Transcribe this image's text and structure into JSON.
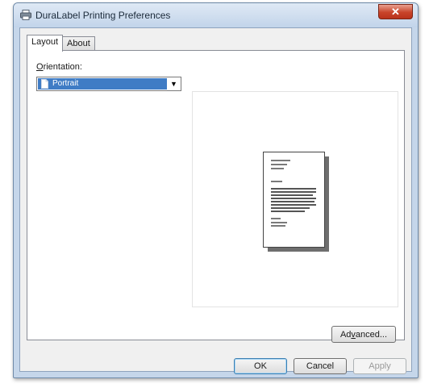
{
  "window": {
    "title": "DuraLabel Printing Preferences",
    "close_symbol": "✕",
    "app_icon": "printer-icon"
  },
  "tabs": [
    {
      "label": "Layout",
      "active": true
    },
    {
      "label": "About",
      "active": false
    }
  ],
  "layout": {
    "orientation_label_accel": "O",
    "orientation_label_rest": "rientation:",
    "orientation_value": "Portrait",
    "orientation_icon": "page-icon",
    "dropdown_icon": "chevron-down-icon"
  },
  "buttons": {
    "advanced_pre": "Ad",
    "advanced_accel": "v",
    "advanced_post": "anced...",
    "ok": "OK",
    "cancel": "Cancel",
    "apply": "Apply"
  },
  "colors": {
    "selection": "#3f7cc5",
    "close_button": "#c8442a",
    "frame": "#c5d6ea"
  }
}
